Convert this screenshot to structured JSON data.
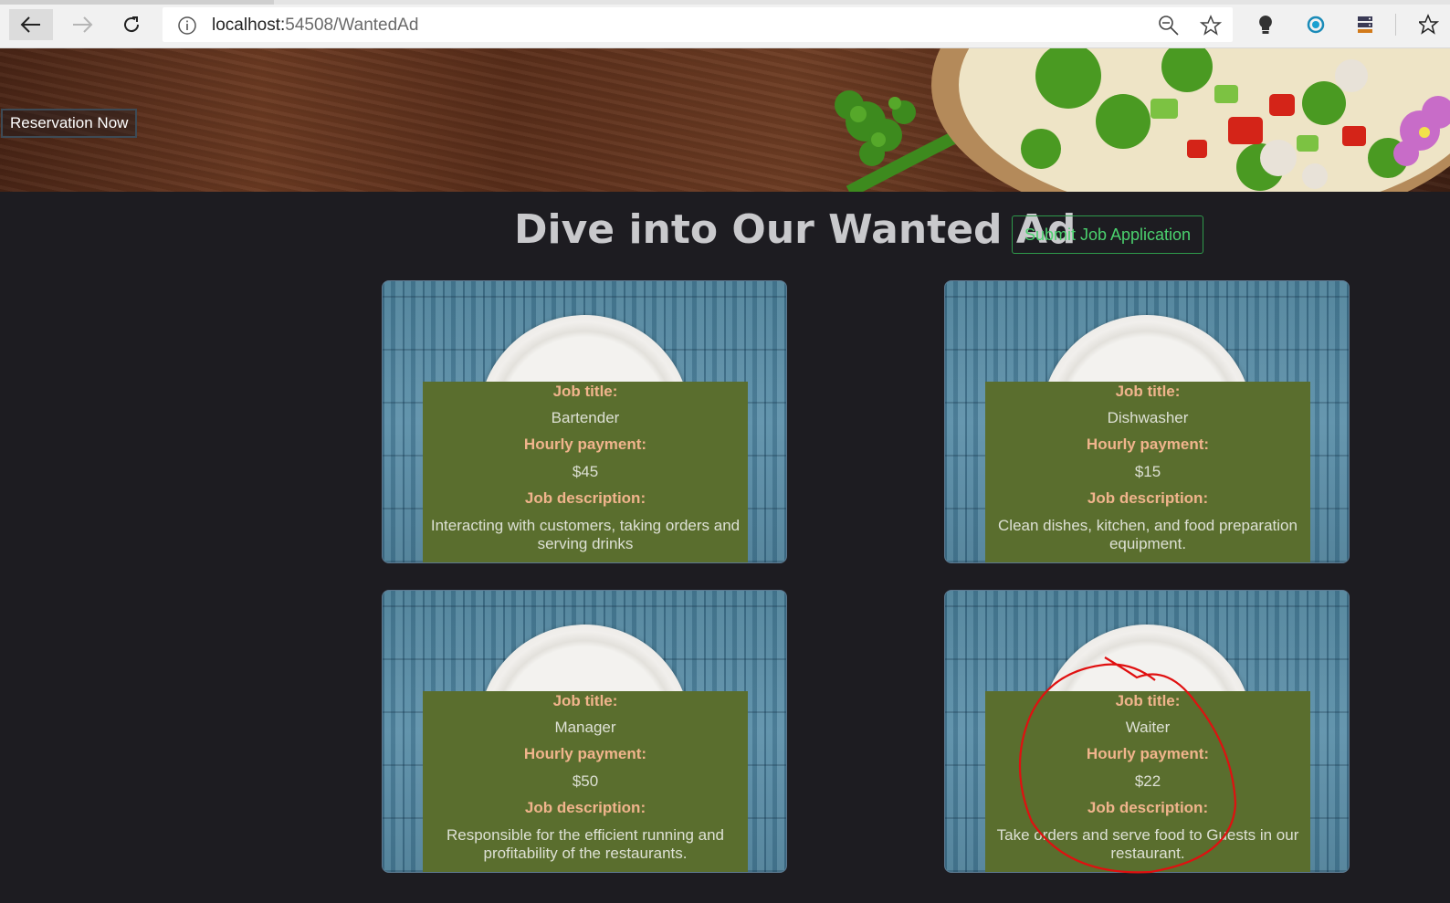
{
  "browser": {
    "url_host": "localhost:",
    "url_path": "54508/WantedAd"
  },
  "hero": {
    "reservation_label": "Reservation Now"
  },
  "heading": {
    "title": "Dive into Our Wanted Ad",
    "submit_label": "Submit Job Application"
  },
  "labels": {
    "job_title": "Job title:",
    "hourly_payment": "Hourly payment:",
    "job_description": "Job description:"
  },
  "jobs": [
    {
      "title": "Bartender",
      "payment": "$45",
      "description": "Interacting with customers, taking orders and serving drinks"
    },
    {
      "title": "Dishwasher",
      "payment": "$15",
      "description": "Clean dishes, kitchen, and food preparation equipment."
    },
    {
      "title": "Manager",
      "payment": "$50",
      "description": "Responsible for the efficient running and profitability of the restaurants."
    },
    {
      "title": "Waiter",
      "payment": "$22",
      "description": "Take orders and serve food to Guests in our restaurant."
    }
  ],
  "colors": {
    "page_bg": "#1d1c21",
    "panel_bg": "#5a6e2e",
    "label_color": "#f0b48c",
    "submit_accent": "#4bd16e",
    "annotation_red": "#e01010"
  },
  "icons": [
    "back-arrow-icon",
    "forward-arrow-icon",
    "refresh-icon",
    "info-icon",
    "zoom-icon",
    "star-icon",
    "lightbulb-icon",
    "record-icon",
    "server-icon"
  ]
}
